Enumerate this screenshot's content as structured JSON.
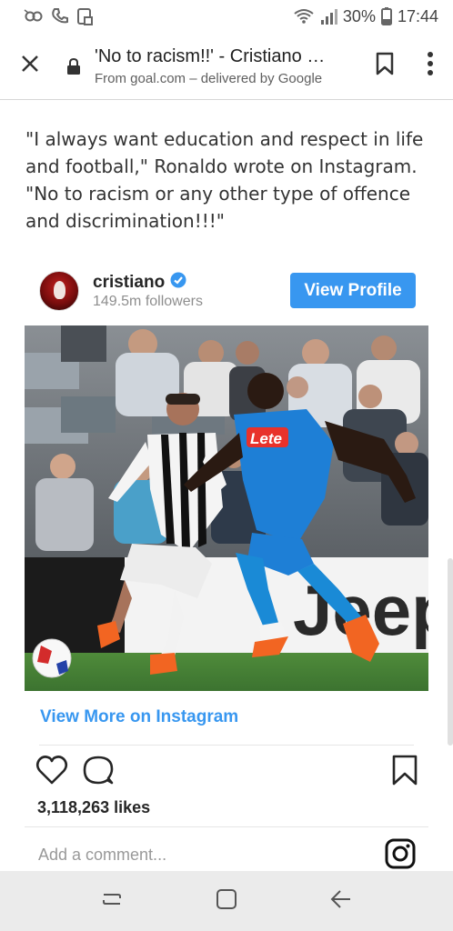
{
  "status_bar": {
    "battery_percent": "30%",
    "time": "17:44",
    "icons": [
      "link-icon",
      "phone-icon",
      "save-icon",
      "wifi-icon",
      "signal-icon",
      "battery-icon"
    ]
  },
  "custom_tab": {
    "title": "'No to racism!!' - Cristiano Ronaldo",
    "subtitle": "From goal.com – delivered by Google",
    "icons": [
      "close-icon",
      "lock-icon",
      "bookmark-icon",
      "more-vert-icon"
    ]
  },
  "article": {
    "paragraph": "\"I always want education and respect in life and football,\" Ronaldo wrote on Instagram. \"No to racism or any other type of offence and discrimination!!!\""
  },
  "instagram": {
    "username": "cristiano",
    "followers": "149.5m followers",
    "view_profile_label": "View Profile",
    "view_more_label": "View More on Instagram",
    "likes": "3,118,263 likes",
    "comment_placeholder": "Add a comment...",
    "accent_color": "#3897f0",
    "photo": {
      "jersey_sponsor": "Lete",
      "board_text": "Jeep"
    }
  },
  "nav_bar": {
    "icons": [
      "recents-icon",
      "home-icon",
      "back-icon"
    ]
  }
}
